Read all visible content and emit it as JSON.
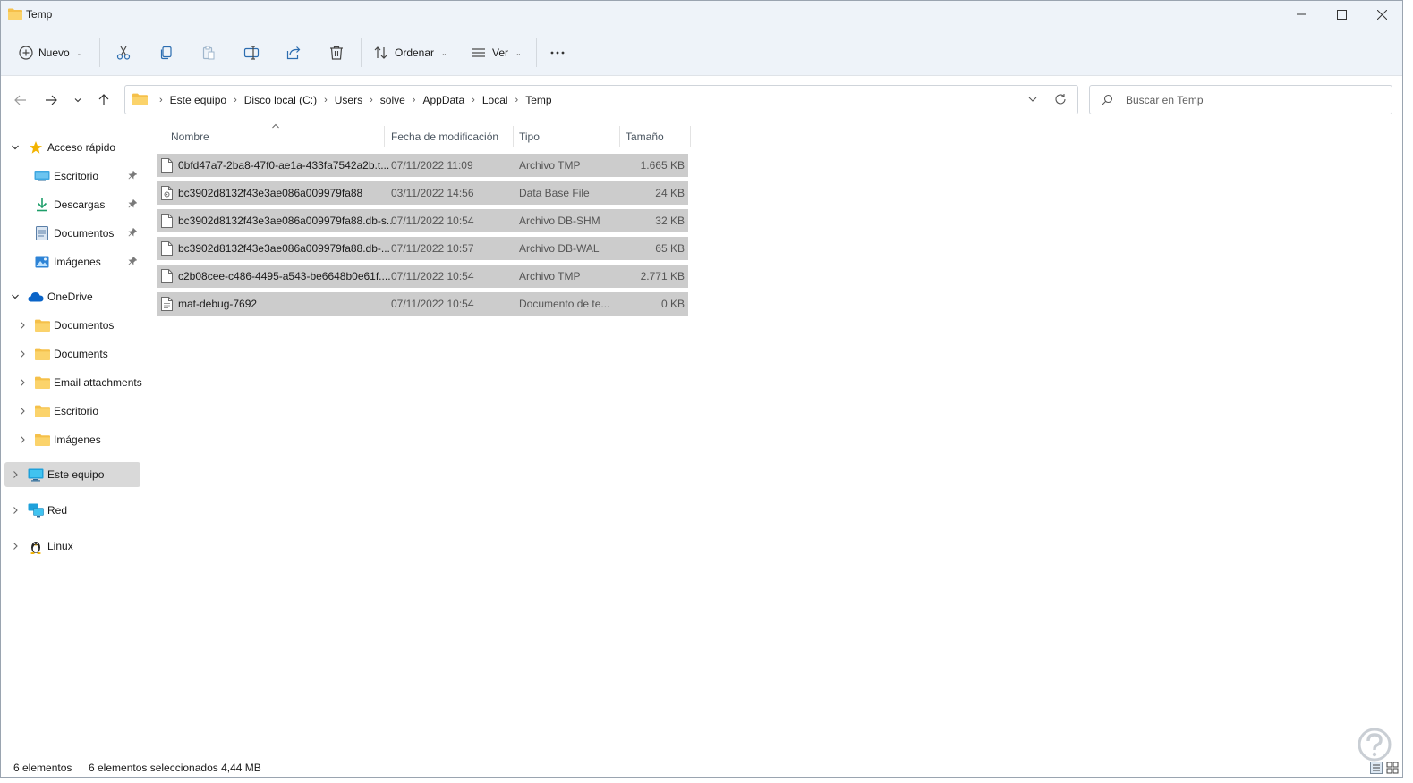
{
  "window": {
    "title": "Temp"
  },
  "toolbar": {
    "new_label": "Nuevo",
    "sort_label": "Ordenar",
    "view_label": "Ver",
    "icons": [
      "cut-icon",
      "copy-icon",
      "paste-icon",
      "rename-icon",
      "share-icon",
      "delete-icon",
      "more-icon"
    ]
  },
  "address": {
    "crumbs": [
      "Este equipo",
      "Disco local (C:)",
      "Users",
      "solve",
      "AppData",
      "Local",
      "Temp"
    ]
  },
  "search": {
    "placeholder": "Buscar en Temp"
  },
  "sidebar": {
    "quick_access": "Acceso rápido",
    "quick_items": [
      {
        "label": "Escritorio",
        "icon": "desktop-icon"
      },
      {
        "label": "Descargas",
        "icon": "download-icon"
      },
      {
        "label": "Documentos",
        "icon": "document-icon"
      },
      {
        "label": "Imágenes",
        "icon": "pictures-icon"
      }
    ],
    "onedrive": "OneDrive",
    "onedrive_items": [
      {
        "label": "Documentos"
      },
      {
        "label": "Documents"
      },
      {
        "label": "Email attachments"
      },
      {
        "label": "Escritorio"
      },
      {
        "label": "Imágenes"
      }
    ],
    "this_pc": "Este equipo",
    "network": "Red",
    "linux": "Linux"
  },
  "columns": {
    "name": "Nombre",
    "date": "Fecha de modificación",
    "type": "Tipo",
    "size": "Tamaño"
  },
  "files": [
    {
      "name": "0bfd47a7-2ba8-47f0-ae1a-433fa7542a2b.t...",
      "date": "07/11/2022 11:09",
      "type": "Archivo TMP",
      "size": "1.665 KB",
      "icon": "file-icon"
    },
    {
      "name": "bc3902d8132f43e3ae086a009979fa88",
      "date": "03/11/2022 14:56",
      "type": "Data Base File",
      "size": "24 KB",
      "icon": "database-file-icon"
    },
    {
      "name": "bc3902d8132f43e3ae086a009979fa88.db-s...",
      "date": "07/11/2022 10:54",
      "type": "Archivo DB-SHM",
      "size": "32 KB",
      "icon": "file-icon"
    },
    {
      "name": "bc3902d8132f43e3ae086a009979fa88.db-...",
      "date": "07/11/2022 10:57",
      "type": "Archivo DB-WAL",
      "size": "65 KB",
      "icon": "file-icon"
    },
    {
      "name": "c2b08cee-c486-4495-a543-be6648b0e61f....",
      "date": "07/11/2022 10:54",
      "type": "Archivo TMP",
      "size": "2.771 KB",
      "icon": "file-icon"
    },
    {
      "name": "mat-debug-7692",
      "date": "07/11/2022 10:54",
      "type": "Documento de te...",
      "size": "0 KB",
      "icon": "text-file-icon"
    }
  ],
  "status": {
    "count": "6 elementos",
    "selected": "6 elementos seleccionados  4,44 MB"
  },
  "colors": {
    "selection": "#cccccc",
    "chrome": "#eef3f9",
    "sidebar_selected": "#d9d9d9",
    "folder": "#f5c04a",
    "star": "#f2b300",
    "onedrive": "#0a64c8"
  }
}
